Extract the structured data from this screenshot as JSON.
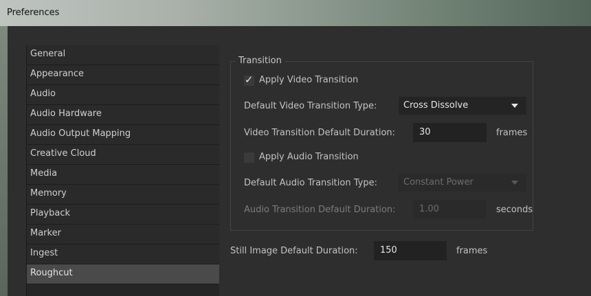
{
  "window": {
    "title": "Preferences"
  },
  "sidebar": {
    "items": [
      {
        "label": "General"
      },
      {
        "label": "Appearance"
      },
      {
        "label": "Audio"
      },
      {
        "label": "Audio Hardware"
      },
      {
        "label": "Audio Output Mapping"
      },
      {
        "label": "Creative Cloud"
      },
      {
        "label": "Media"
      },
      {
        "label": "Memory"
      },
      {
        "label": "Playback"
      },
      {
        "label": "Marker"
      },
      {
        "label": "Ingest"
      },
      {
        "label": "Roughcut"
      }
    ],
    "selected": "Roughcut"
  },
  "transition": {
    "group_label": "Transition",
    "apply_video": {
      "label": "Apply Video Transition",
      "checked": true
    },
    "video_type": {
      "label": "Default Video Transition Type:",
      "value": "Cross Dissolve"
    },
    "video_duration": {
      "label": "Video Transition Default Duration:",
      "value": "30",
      "unit": "frames"
    },
    "apply_audio": {
      "label": "Apply Audio Transition",
      "checked": false
    },
    "audio_type": {
      "label": "Default Audio Transition Type:",
      "value": "Constant Power"
    },
    "audio_duration": {
      "label": "Audio Transition Default Duration:",
      "value": "1.00",
      "unit": "seconds"
    }
  },
  "still_image": {
    "label": "Still Image Default Duration:",
    "value": "150",
    "unit": "frames"
  },
  "icons": {
    "checkmark": "checkmark-icon",
    "dropdown": "chevron-down-icon"
  }
}
